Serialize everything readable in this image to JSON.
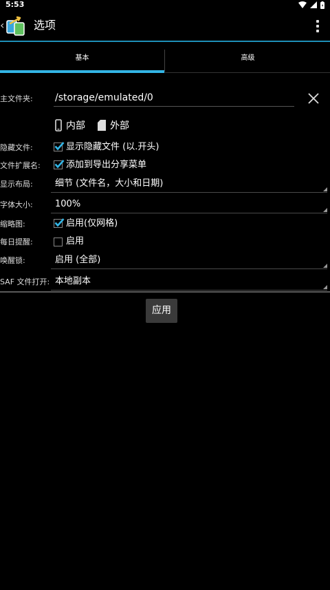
{
  "status": {
    "time": "5:53"
  },
  "header": {
    "title": "选项"
  },
  "tabs": [
    {
      "label": "基本",
      "selected": true
    },
    {
      "label": "高级",
      "selected": false
    }
  ],
  "home_folder": {
    "label": "主文件夹:",
    "value": "/storage/emulated/0"
  },
  "storage": {
    "internal": "内部",
    "external": "外部"
  },
  "hidden_files": {
    "label": "隐藏文件:",
    "option": "显示隐藏文件 (以.开头)",
    "checked": true
  },
  "extensions": {
    "label": "文件扩展名:",
    "option": "添加到导出分享菜单",
    "checked": true
  },
  "layout": {
    "label": "显示布局:",
    "value": "细节 (文件名，大小和日期)"
  },
  "font_size": {
    "label": "字体大小:",
    "value": "100%"
  },
  "thumbnails": {
    "label": "缩略图:",
    "option": "启用(仅网格)",
    "checked": true
  },
  "daily_reminder": {
    "label": "每日提醒:",
    "option": "启用",
    "checked": false
  },
  "wake_lock": {
    "label": "唤醒锁:",
    "value": "启用 (全部)"
  },
  "saf_open": {
    "label": "SAF 文件打开:",
    "value": "本地副本"
  },
  "apply_button": "应用",
  "colors": {
    "accent": "#33b5e5",
    "background": "#000000",
    "button": "#3a3a3a"
  }
}
